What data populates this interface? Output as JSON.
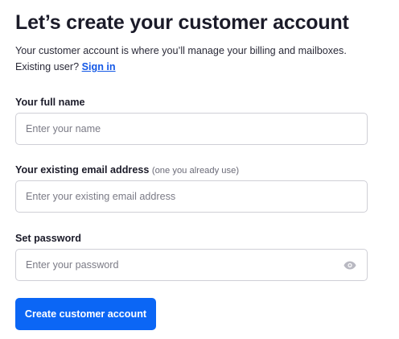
{
  "header": {
    "title": "Let’s create your customer account",
    "subtitle": "Your customer account is where you’ll manage your billing and mailboxes.",
    "existing_user_text": "Existing user?",
    "sign_in_link": "Sign in"
  },
  "form": {
    "full_name": {
      "label": "Your full name",
      "value": "",
      "placeholder": "Enter your name"
    },
    "email": {
      "label": "Your existing email address",
      "hint": "(one you already use)",
      "value": "",
      "placeholder": "Enter your existing email address"
    },
    "password": {
      "label": "Set password",
      "value": "",
      "placeholder": "Enter your password",
      "toggle_icon": "eye-icon"
    },
    "submit_label": "Create customer account"
  },
  "colors": {
    "accent": "#0b66f5",
    "link": "#1559e6",
    "border": "#cfcfd6"
  }
}
